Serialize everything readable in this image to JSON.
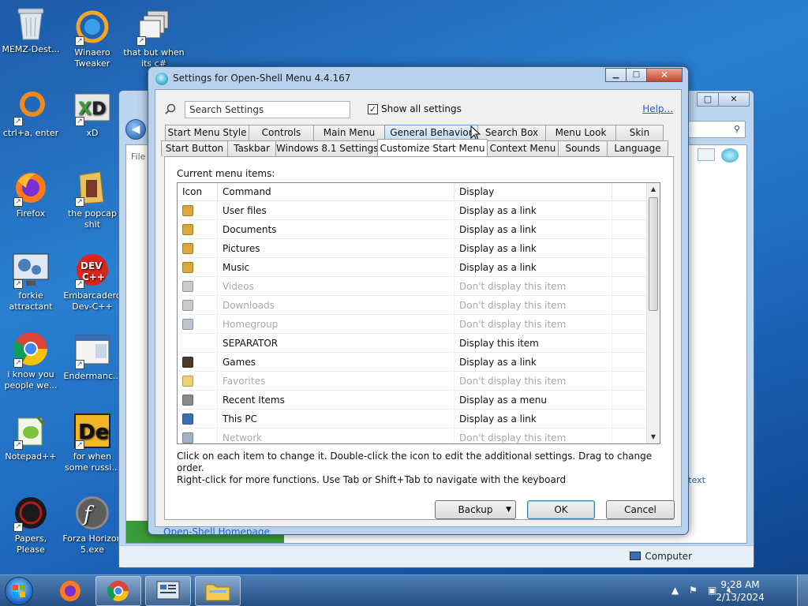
{
  "desktop": {
    "icons": [
      {
        "label": "MEMZ-Dest...",
        "icon": "recycle-bin-icon"
      },
      {
        "label": "Winaero Tweaker",
        "icon": "winaero-icon"
      },
      {
        "label": "that but when its c#",
        "icon": "windows-stack-icon"
      },
      {
        "label": "ctrl+a, enter",
        "icon": "ring-icon"
      },
      {
        "label": "xD",
        "icon": "xd-icon"
      },
      {
        "label": "Firefox",
        "icon": "firefox-icon"
      },
      {
        "label": "the popcap shit",
        "icon": "folder-icon"
      },
      {
        "label": "forkie attractant",
        "icon": "monitor-gears-icon"
      },
      {
        "label": "Embarcadero Dev-C++",
        "icon": "devcpp-icon"
      },
      {
        "label": "i know you people we...",
        "icon": "chrome-icon"
      },
      {
        "label": "Endermanc...",
        "icon": "app-window-icon"
      },
      {
        "label": "Notepad++",
        "icon": "notepadpp-icon"
      },
      {
        "label": "for when some russi...",
        "icon": "de-icon"
      },
      {
        "label": "Papers, Please",
        "icon": "papers-please-icon"
      },
      {
        "label": "Forza Horizon 5.exe",
        "icon": "flash-icon"
      }
    ]
  },
  "background_window": {
    "partial_label": "File",
    "status_text": "Computer",
    "partial_text": "e text"
  },
  "dialog": {
    "title": "Settings for Open-Shell Menu 4.4.167",
    "caption_buttons": {
      "minimize": "▁",
      "maximize": "□",
      "close": "✕"
    },
    "search": {
      "value": "Search Settings"
    },
    "show_all": {
      "label": "Show all settings",
      "checked": true
    },
    "help_link": "Help...",
    "tabs_row1": [
      "Start Menu Style",
      "Controls",
      "Main Menu",
      "General Behavior",
      "Search Box",
      "Menu Look",
      "Skin"
    ],
    "tabs_row2": [
      "Start Button",
      "Taskbar",
      "Windows 8.1 Settings",
      "Customize Start Menu",
      "Context Menu",
      "Sounds",
      "Language"
    ],
    "active_tab": "Customize Start Menu",
    "hover_tab": "General Behavior",
    "panel_label": "Current menu items:",
    "columns": [
      "Icon",
      "Command",
      "Display"
    ],
    "items": [
      {
        "command": "User files",
        "display": "Display as a link",
        "enabled": true,
        "icon": "user-folder-icon",
        "color": "#d9a93b"
      },
      {
        "command": "Documents",
        "display": "Display as a link",
        "enabled": true,
        "icon": "documents-folder-icon",
        "color": "#d9a93b"
      },
      {
        "command": "Pictures",
        "display": "Display as a link",
        "enabled": true,
        "icon": "pictures-folder-icon",
        "color": "#d9a93b"
      },
      {
        "command": "Music",
        "display": "Display as a link",
        "enabled": true,
        "icon": "music-folder-icon",
        "color": "#d9a93b"
      },
      {
        "command": "Videos",
        "display": "Don't display this item",
        "enabled": false,
        "icon": "videos-folder-icon",
        "color": "#c9c9c9"
      },
      {
        "command": "Downloads",
        "display": "Don't display this item",
        "enabled": false,
        "icon": "downloads-folder-icon",
        "color": "#c9c9c9"
      },
      {
        "command": "Homegroup",
        "display": "Don't display this item",
        "enabled": false,
        "icon": "homegroup-icon",
        "color": "#b8c4d0"
      },
      {
        "command": "SEPARATOR",
        "display": "Display this item",
        "enabled": true,
        "icon": "",
        "color": ""
      },
      {
        "command": "Games",
        "display": "Display as a link",
        "enabled": true,
        "icon": "games-icon",
        "color": "#4a3a26"
      },
      {
        "command": "Favorites",
        "display": "Don't display this item",
        "enabled": false,
        "icon": "favorites-star-icon",
        "color": "#f0d070"
      },
      {
        "command": "Recent Items",
        "display": "Display as a menu",
        "enabled": true,
        "icon": "recent-items-icon",
        "color": "#8a8a8a"
      },
      {
        "command": "This PC",
        "display": "Display as a link",
        "enabled": true,
        "icon": "this-pc-icon",
        "color": "#3b6fb5"
      },
      {
        "command": "Network",
        "display": "Don't display this item",
        "enabled": false,
        "icon": "network-icon",
        "color": "#9fb3c8"
      }
    ],
    "hint_line1": "Click on each item to change it. Double-click the icon to edit the additional settings. Drag to change order.",
    "hint_line2": "Right-click for more functions. Use Tab or Shift+Tab to navigate with the keyboard",
    "homepage_link": "Open-Shell Homepage",
    "buttons": {
      "backup": "Backup",
      "ok": "OK",
      "cancel": "Cancel"
    }
  },
  "taskbar": {
    "clock_time": "9:28 AM",
    "clock_date": "2/13/2024",
    "pinned": [
      "firefox-icon",
      "chrome-icon",
      "control-panel-icon",
      "file-explorer-icon"
    ]
  },
  "colors": {
    "link": "#1e5ed8",
    "disabled_text": "#a8a8a8",
    "dialog_frame": "#b8d1ec"
  }
}
